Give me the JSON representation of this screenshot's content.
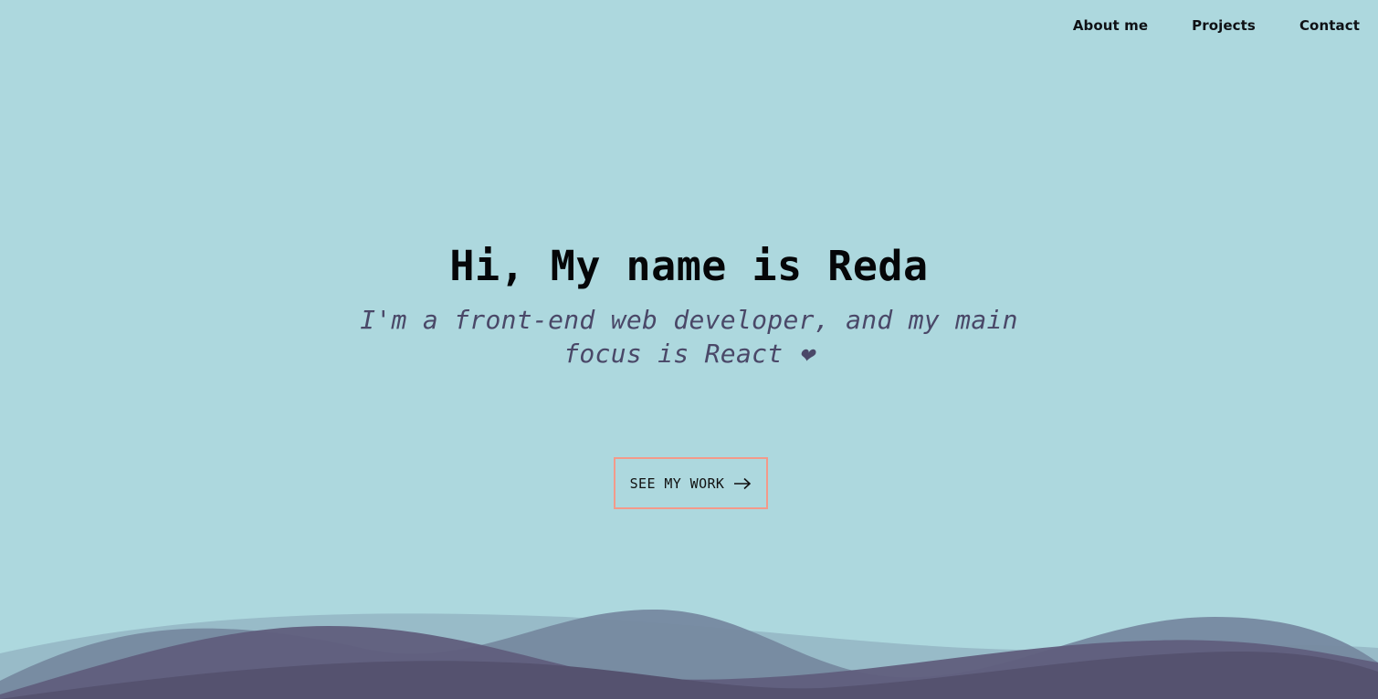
{
  "nav": {
    "items": [
      {
        "label": "About me"
      },
      {
        "label": "Projects"
      },
      {
        "label": "Contact"
      }
    ]
  },
  "hero": {
    "title": "Hi, My name is Reda",
    "subtitle": "I'm a front-end web developer, and my main focus is React ❤"
  },
  "cta": {
    "label": "SEE MY WORK",
    "icon": "arrow-right-icon"
  },
  "colors": {
    "background": "#add8de",
    "cta_border": "#f39a8a",
    "subtitle": "#4a4868",
    "wave_dark": "#55526f"
  }
}
